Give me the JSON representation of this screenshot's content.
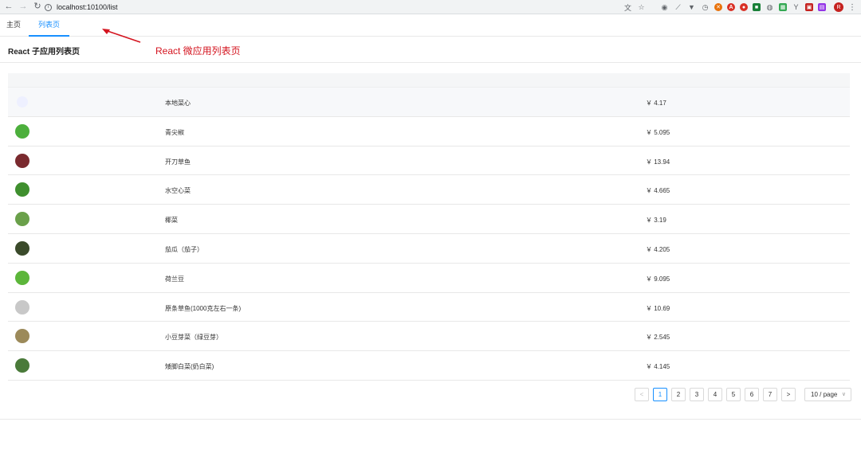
{
  "browser": {
    "url": "localhost:10100/list",
    "avatar_letter": "R"
  },
  "app_tabs": [
    {
      "label": "主页"
    },
    {
      "label": "列表页"
    }
  ],
  "annotation": {
    "text": "React 微应用列表页",
    "color": "#d4141f"
  },
  "page": {
    "title": "React 子应用列表页"
  },
  "table": {
    "rows": [
      {
        "name": "本地菜心",
        "price": "￥ 4.17",
        "thumb_color": "#eef0ff"
      },
      {
        "name": "青尖椒",
        "price": "￥ 5.095",
        "thumb_color": "#4caf3c"
      },
      {
        "name": "开刀草鱼",
        "price": "￥ 13.94",
        "thumb_color": "#7a2a2f"
      },
      {
        "name": "水空心菜",
        "price": "￥ 4.665",
        "thumb_color": "#3f8f2e"
      },
      {
        "name": "椰菜",
        "price": "￥ 3.19",
        "thumb_color": "#6aa04a"
      },
      {
        "name": "茄瓜（茄子）",
        "price": "￥ 4.205",
        "thumb_color": "#3a4a2a"
      },
      {
        "name": "荷兰豆",
        "price": "￥ 9.095",
        "thumb_color": "#5cb63a"
      },
      {
        "name": "原条草鱼(1000克左右一条)",
        "price": "￥ 10.69",
        "thumb_color": "#c8c8c8"
      },
      {
        "name": "小豆芽菜（绿豆芽）",
        "price": "￥ 2.545",
        "thumb_color": "#9c8a5a"
      },
      {
        "name": "矮脚白菜(奶白菜)",
        "price": "￥ 4.145",
        "thumb_color": "#4a7a3a"
      }
    ]
  },
  "pagination": {
    "prev": "<",
    "next": ">",
    "pages": [
      "1",
      "2",
      "3",
      "4",
      "5",
      "6",
      "7"
    ],
    "current": "1",
    "page_size": "10 / page"
  },
  "colors": {
    "accent": "#1890ff",
    "annotation": "#d4141f"
  }
}
